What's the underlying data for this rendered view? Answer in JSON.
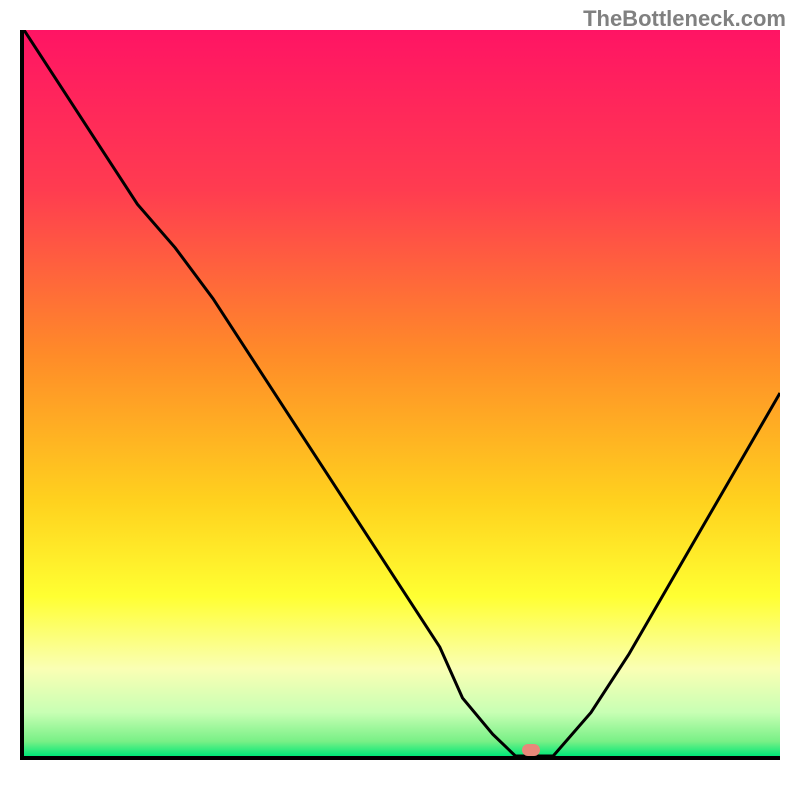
{
  "watermark": "TheBottleneck.com",
  "chart_data": {
    "type": "line",
    "title": "",
    "xlabel": "",
    "ylabel": "",
    "xlim": [
      0,
      100
    ],
    "ylim": [
      0,
      100
    ],
    "x": [
      0,
      5,
      10,
      15,
      20,
      25,
      30,
      35,
      40,
      45,
      50,
      55,
      58,
      62,
      65,
      70,
      75,
      80,
      85,
      90,
      95,
      100
    ],
    "values": [
      100,
      92,
      84,
      76,
      70,
      63,
      55,
      47,
      39,
      31,
      23,
      15,
      8,
      3,
      0,
      0,
      6,
      14,
      23,
      32,
      41,
      50
    ],
    "marker": {
      "x_pct": 67,
      "y_pct": 0
    },
    "gradient_stops": [
      {
        "offset": 0,
        "color": "#ff1464"
      },
      {
        "offset": 22,
        "color": "#ff3c50"
      },
      {
        "offset": 45,
        "color": "#ff8c28"
      },
      {
        "offset": 65,
        "color": "#ffd21e"
      },
      {
        "offset": 78,
        "color": "#ffff32"
      },
      {
        "offset": 88,
        "color": "#faffb4"
      },
      {
        "offset": 94,
        "color": "#c8ffb4"
      },
      {
        "offset": 98,
        "color": "#78f086"
      },
      {
        "offset": 100,
        "color": "#00e878"
      }
    ]
  }
}
